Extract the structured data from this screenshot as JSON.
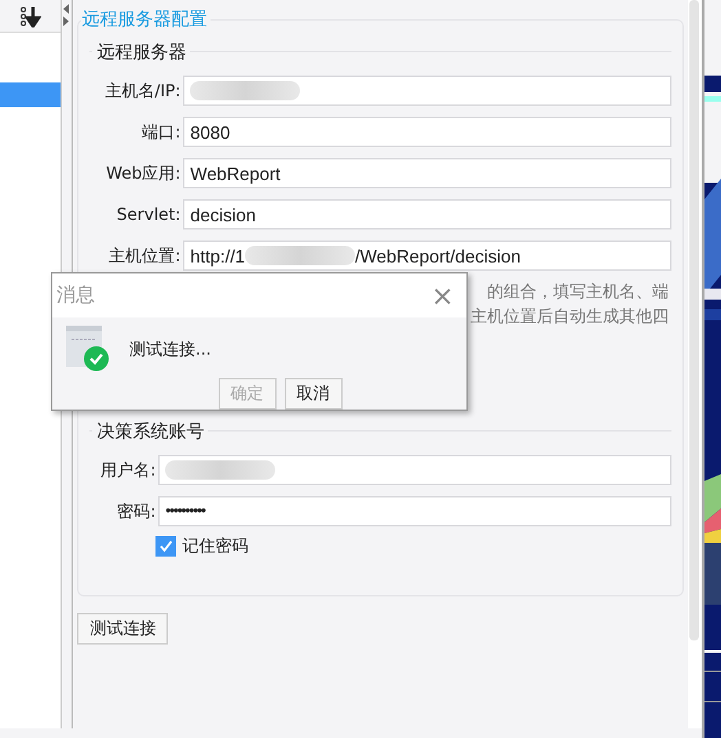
{
  "sidebar": {
    "items": [
      {
        "selected": false
      },
      {
        "selected": false
      },
      {
        "selected": true
      }
    ]
  },
  "panel": {
    "title": "远程服务器配置",
    "server_group": {
      "title": "远程服务器",
      "fields": [
        {
          "label": "主机名/IP:",
          "redacted": true
        },
        {
          "label": "端口:",
          "value": "8080",
          "redacted": false
        },
        {
          "label": "Web应用:",
          "value": "WebReport",
          "redacted": false
        },
        {
          "label": "Servlet:",
          "value": "decision",
          "redacted": false
        },
        {
          "label": "主机位置:",
          "value": "http://1",
          "redacted": true,
          "value_end": "/WebReport/decision"
        }
      ],
      "hint_lines": [
        "的组合，填写主机名、端",
        "主机位置后自动生成其他四"
      ]
    },
    "account_group": {
      "title": "决策系统账号",
      "fields": [
        {
          "label": "用户名:",
          "redacted": true
        },
        {
          "label": "密码:",
          "value": "••••••••••",
          "redacted": false
        }
      ],
      "remember": {
        "label": "记住密码",
        "checked": true
      }
    },
    "test_button": "测试连接"
  },
  "dialog": {
    "title": "消息",
    "close": "×",
    "message": "测试连接...",
    "buttons": [
      {
        "label": "确定",
        "disabled": true
      },
      {
        "label": "取消",
        "disabled": false
      }
    ]
  }
}
